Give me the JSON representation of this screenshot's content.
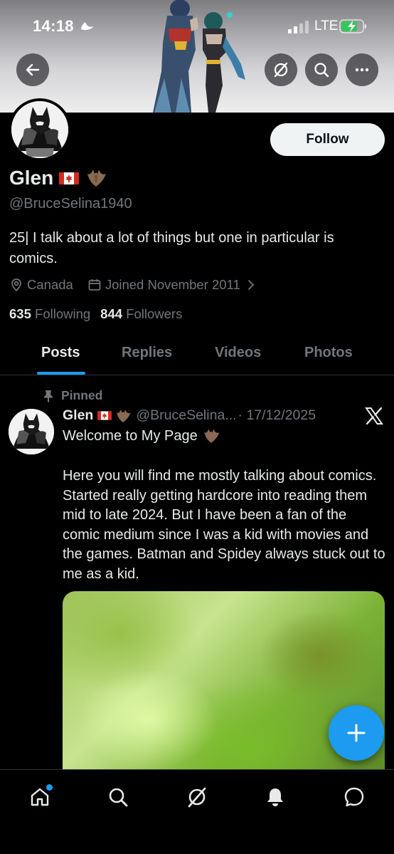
{
  "status_bar": {
    "time": "14:18",
    "network": "LTE",
    "icons": [
      "moon-icon",
      "signal-icon",
      "battery-charging-icon"
    ]
  },
  "header": {
    "buttons": [
      "back-arrow-icon",
      "grok-icon",
      "search-icon",
      "more-icon"
    ]
  },
  "profile": {
    "display_name": "Glen",
    "handle": "@BruceSelina1940",
    "bio": "25| I talk about a lot of things but one in particular is comics.",
    "location": "Canada",
    "joined": "Joined November 2011",
    "following_count": "635",
    "following_label": "Following",
    "followers_count": "844",
    "followers_label": "Followers",
    "follow_label": "Follow"
  },
  "tabs": [
    {
      "label": "Posts",
      "active": true
    },
    {
      "label": "Replies",
      "active": false
    },
    {
      "label": "Videos",
      "active": false
    },
    {
      "label": "Photos",
      "active": false
    }
  ],
  "pinned_post": {
    "pinned_label": "Pinned",
    "author_name": "Glen",
    "author_handle": "@BruceSelina...",
    "date": "· 17/12/2025",
    "title": "Welcome to My Page",
    "body": "Here you will find me mostly talking about comics. Started really getting hardcore into reading them mid to late 2024. But I have been a fan of the comic medium since I was a kid with movies and the games. Batman and Spidey always stuck out to me as a kid."
  },
  "bottom_nav": [
    "home-icon",
    "search-icon",
    "grok-icon",
    "notifications-icon",
    "messages-icon"
  ],
  "colors": {
    "accent": "#1d9bf0",
    "background": "#000000",
    "text_primary": "#e7e9ea",
    "text_secondary": "#71767b"
  }
}
